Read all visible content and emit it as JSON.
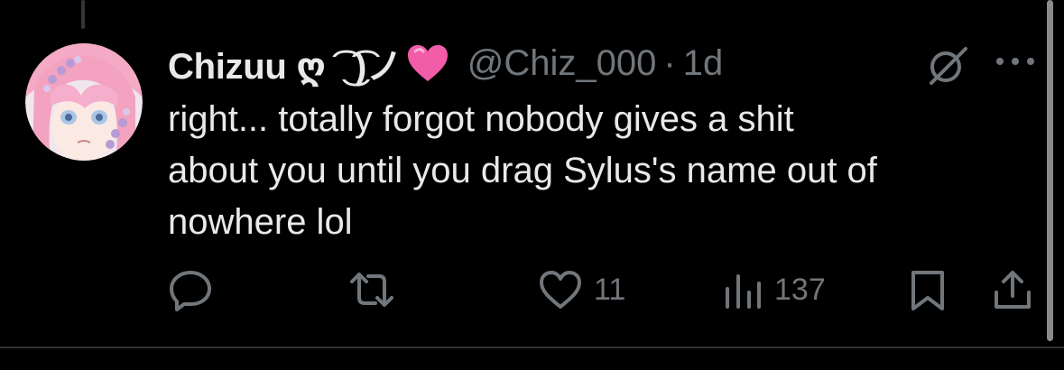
{
  "post": {
    "display_name": "Chizuu ღ ͡ ͜ ͡)ノ",
    "emoji": "pink-heart",
    "handle": "@Chiz_000",
    "separator": "·",
    "timestamp": "1d",
    "text": "right... totally forgot nobody gives a shit\nabout you until you drag Sylus's name out of\nnowhere lol"
  },
  "actions": {
    "reply_icon": "reply-icon",
    "repost_icon": "repost-icon",
    "like_icon": "heart-icon",
    "like_count": "11",
    "views_icon": "views-bar-chart-icon",
    "views_count": "137",
    "bookmark_icon": "bookmark-icon",
    "share_icon": "share-icon"
  },
  "colors": {
    "background": "#000000",
    "text_primary": "#e7e9ea",
    "text_secondary": "#71767b",
    "emoji_pink": "#f25ca8"
  }
}
